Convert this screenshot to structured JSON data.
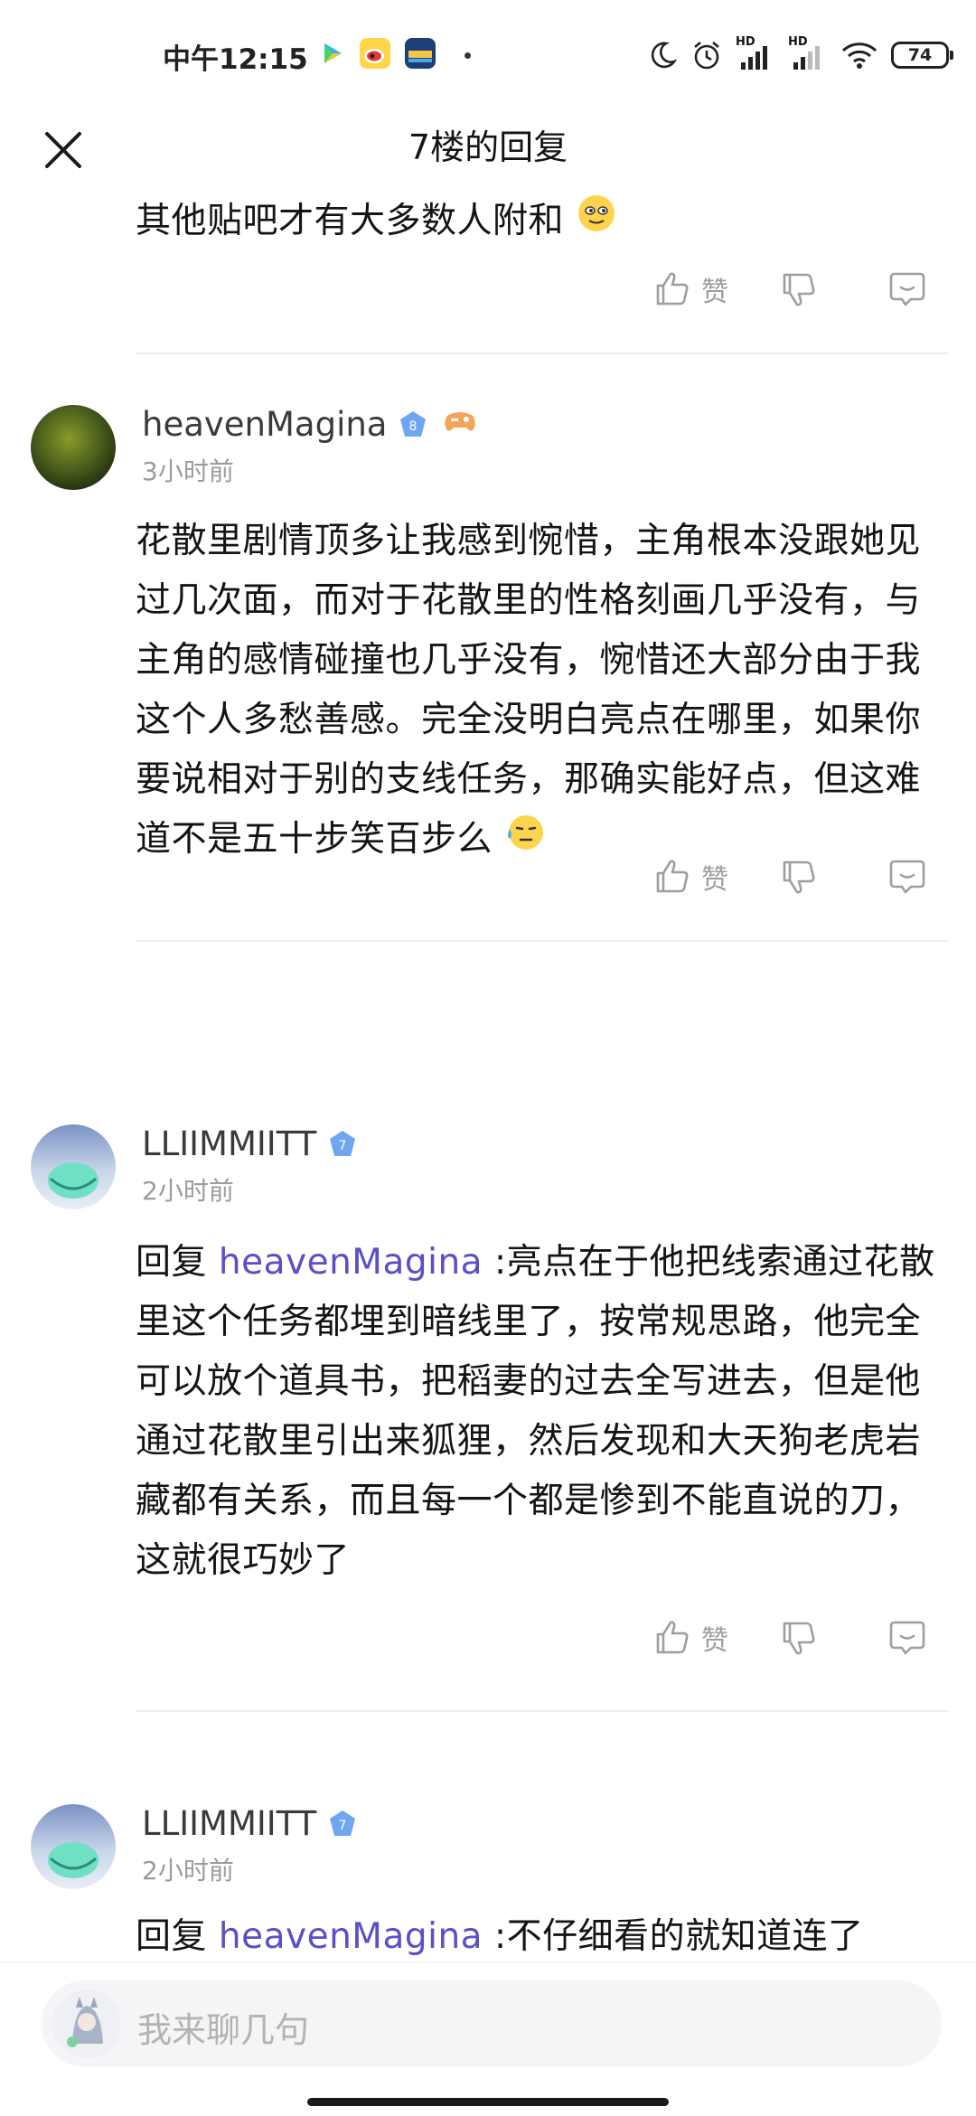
{
  "status_bar": {
    "time": "中午12:15",
    "battery": "74",
    "hd1": "HD",
    "hd2": "HD"
  },
  "header": {
    "title": "7楼的回复"
  },
  "comments": [
    {
      "text": "其他贴吧才有大多数人附和",
      "like_label": "赞"
    },
    {
      "username": "heavenMagina",
      "level": "8",
      "time": "3小时前",
      "text": "花散里剧情顶多让我感到惋惜，主角根本没跟她见过几次面，而对于花散里的性格刻画几乎没有，与主角的感情碰撞也几乎没有，惋惜还大部分由于我这个人多愁善感。完全没明白亮点在哪里，如果你要说相对于别的支线任务，那确实能好点，但这难道不是五十步笑百步么",
      "like_label": "赞"
    },
    {
      "username": "LLIIMMIITT",
      "level": "7",
      "time": "2小时前",
      "reply_prefix": "回复 ",
      "mention": "heavenMagina",
      "text": " :亮点在于他把线索通过花散里这个任务都埋到暗线里了，按常规思路，他完全可以放个道具书，把稻妻的过去全写进去，但是他通过花散里引出来狐狸，然后发现和大天狗老虎岩藏都有关系，而且每一个都是惨到不能直说的刀，这就很巧妙了",
      "like_label": "赞"
    },
    {
      "username": "LLIIMMIITT",
      "level": "7",
      "time": "2小时前",
      "reply_prefix": "回复 ",
      "mention": "heavenMagina",
      "text": " :不仔细看的就知道连了"
    }
  ],
  "input": {
    "placeholder": "我来聊几句"
  },
  "colors": {
    "mention": "#5b4fc7",
    "badge": "#6ea6f2",
    "muted": "#9e9e9e"
  }
}
